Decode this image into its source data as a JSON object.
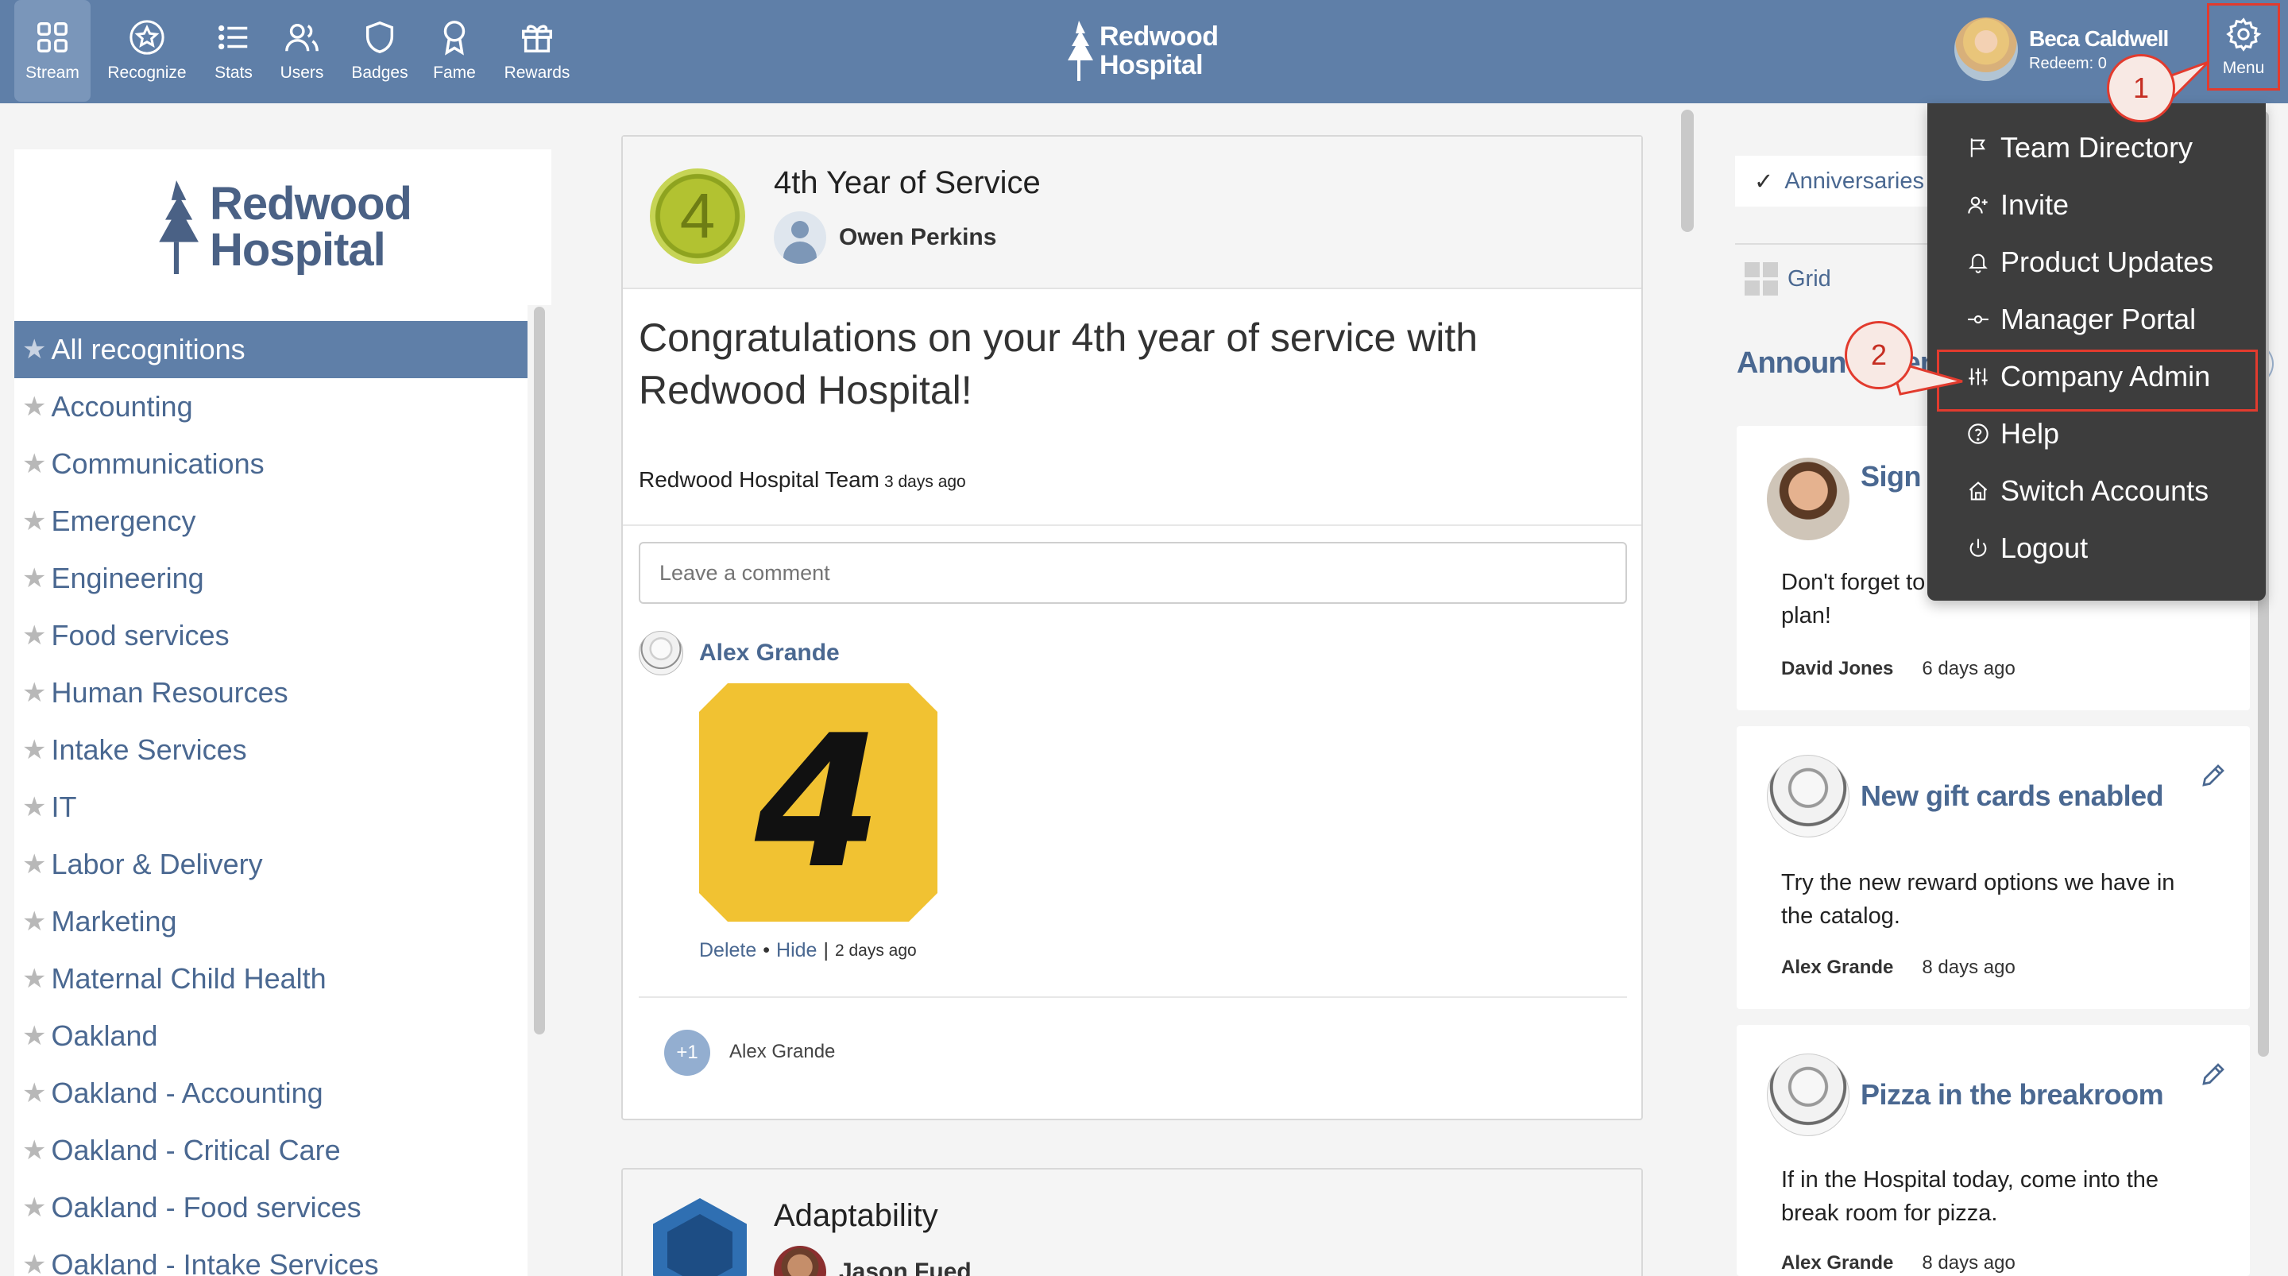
{
  "nav": {
    "items": [
      {
        "label": "Stream",
        "icon": "grid-icon"
      },
      {
        "label": "Recognize",
        "icon": "star-icon"
      },
      {
        "label": "Stats",
        "icon": "list-icon"
      },
      {
        "label": "Users",
        "icon": "users-icon"
      },
      {
        "label": "Badges",
        "icon": "shield-icon"
      },
      {
        "label": "Fame",
        "icon": "ribbon-icon"
      },
      {
        "label": "Rewards",
        "icon": "gift-icon"
      }
    ],
    "brand_line1": "Redwood",
    "brand_line2": "Hospital",
    "user_name": "Beca Caldwell",
    "user_redeem": "Redeem: 0",
    "menu_label": "Menu"
  },
  "sidebar": {
    "logo_line1": "Redwood",
    "logo_line2": "Hospital",
    "all_label": "All recognitions",
    "categories": [
      "Accounting",
      "Communications",
      "Emergency",
      "Engineering",
      "Food services",
      "Human Resources",
      "Intake Services",
      "IT",
      "Labor & Delivery",
      "Marketing",
      "Maternal Child Health",
      "Oakland",
      "Oakland - Accounting",
      "Oakland - Critical Care",
      "Oakland - Food services",
      "Oakland - Intake Services"
    ]
  },
  "feed": {
    "post1": {
      "badge_number": "4",
      "title": "4th Year of Service",
      "recipient": "Owen Perkins",
      "message": "Congratulations on your 4th year of service with Redwood Hospital!",
      "from": "Redwood Hospital Team",
      "from_ago": "3 days ago",
      "comment_placeholder": "Leave a comment",
      "commenter": "Alex Grande",
      "comment_image_text": "4",
      "delete_label": "Delete",
      "hide_label": "Hide",
      "comment_ago": "2 days ago",
      "plus_label": "+1",
      "plus_name": "Alex Grande"
    },
    "post2": {
      "title": "Adaptability",
      "recipient": "Jason Fued"
    }
  },
  "right": {
    "filter_label": "Anniversaries",
    "grid_label": "Grid",
    "announcements_heading": "Announcements",
    "cards": [
      {
        "title": "Sign up for insurance",
        "body": "Don't forget to sign up for your insurance plan!",
        "author": "David Jones",
        "ago": "6 days ago"
      },
      {
        "title": "New gift cards enabled",
        "body": "Try the new reward options we have in the catalog.",
        "author": "Alex Grande",
        "ago": "8 days ago"
      },
      {
        "title": "Pizza in the breakroom",
        "body": "If in the Hospital today, come into the break room for pizza.",
        "author": "Alex Grande",
        "ago": "8 days ago"
      }
    ]
  },
  "menu": {
    "items": [
      {
        "label": "Team Directory",
        "icon": "flag-icon"
      },
      {
        "label": "Invite",
        "icon": "user-plus-icon"
      },
      {
        "label": "Product Updates",
        "icon": "bell-icon"
      },
      {
        "label": "Manager Portal",
        "icon": "key-icon"
      },
      {
        "label": "Company Admin",
        "icon": "sliders-icon"
      },
      {
        "label": "Help",
        "icon": "help-circle-icon"
      },
      {
        "label": "Switch Accounts",
        "icon": "home-icon"
      },
      {
        "label": "Logout",
        "icon": "power-icon"
      }
    ]
  },
  "callouts": {
    "one": "1",
    "two": "2"
  },
  "colors": {
    "nav_bg": "#5f7fa8",
    "accent": "#4a6891",
    "menu_bg": "#3d3d3d",
    "callout_red": "#e23b2e"
  }
}
